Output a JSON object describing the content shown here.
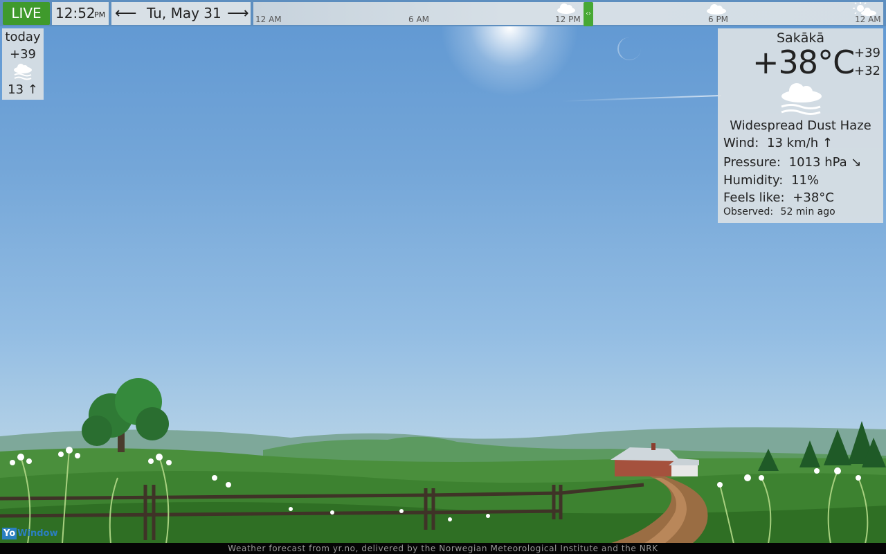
{
  "header": {
    "live_label": "LIVE",
    "time": "12:52",
    "ampm": "PM",
    "date": "Tu, May 31",
    "prev_icon": "arrow-left-icon",
    "next_icon": "arrow-right-icon"
  },
  "timeline": {
    "ticks": [
      "12 AM",
      "6 AM",
      "12 PM",
      "6 PM",
      "12 AM"
    ],
    "icons": [
      "cloud-icon",
      "cloud-icon",
      "partly-sunny-icon"
    ]
  },
  "today": {
    "label": "today",
    "temp": "+39",
    "icon": "dust-haze-icon",
    "wind": "13 ↑"
  },
  "current": {
    "city": "Sakākā",
    "temp": "+38°C",
    "high": "+39",
    "low": "+32",
    "icon": "dust-haze-icon",
    "condition": "Widespread Dust Haze",
    "wind_label": "Wind:",
    "wind_value": "13 km/h ↑",
    "pressure_label": "Pressure:",
    "pressure_value": "1013 hPa ↘",
    "humidity_label": "Humidity:",
    "humidity_value": "11%",
    "feels_label": "Feels like:",
    "feels_value": "+38°C",
    "observed_label": "Observed:",
    "observed_value": "52 min ago"
  },
  "footer": {
    "credit": "Weather forecast from yr.no, delivered by the Norwegian Meteorological Institute and the NRK",
    "logo_yo": "Yo",
    "logo_window": "Window"
  },
  "colors": {
    "live": "#3f9a2c",
    "now_marker": "#47a834",
    "panel": "#d7dee4",
    "sky_top": "#5f97d2"
  }
}
